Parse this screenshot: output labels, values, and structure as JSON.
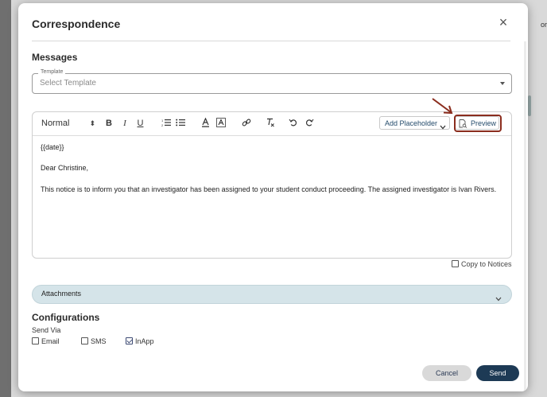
{
  "background": {
    "fragment": "or"
  },
  "modal": {
    "title": "Correspondence",
    "close_label": "×"
  },
  "messages": {
    "section_title": "Messages",
    "template": {
      "legend": "Template",
      "placeholder": "Select Template"
    }
  },
  "editor": {
    "toolbar": {
      "format_value": "Normal",
      "bold": "B",
      "italic": "I",
      "underline": "U",
      "add_placeholder_label": "Add Placeholder",
      "preview_label": "Preview"
    },
    "content": {
      "line1": "{{date}}",
      "line2": "Dear Christine,",
      "line3": "This notice is to inform you that an investigator has been assigned to your student conduct proceeding. The assigned investigator is Ivan Rivers."
    }
  },
  "copy_to_notices": {
    "label": "Copy to Notices",
    "checked": false
  },
  "attachments": {
    "label": "Attachments"
  },
  "configurations": {
    "section_title": "Configurations",
    "send_via_label": "Send Via",
    "options": [
      {
        "label": "Email",
        "checked": false
      },
      {
        "label": "SMS",
        "checked": false
      },
      {
        "label": "InApp",
        "checked": true
      }
    ]
  },
  "footer": {
    "cancel_label": "Cancel",
    "send_label": "Send"
  },
  "colors": {
    "primary": "#1d3a55",
    "accent_annotation": "#8b2d1e",
    "attachments_bg": "#d5e4e9"
  }
}
